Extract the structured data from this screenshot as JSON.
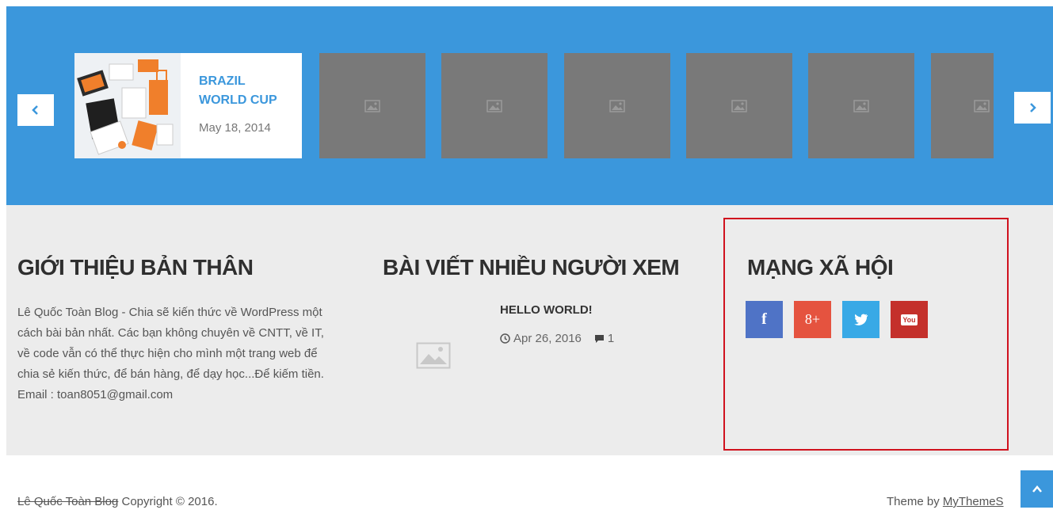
{
  "carousel": {
    "featured": {
      "title": "BRAZIL WORLD CUP",
      "date": "May 18, 2014"
    },
    "prev_icon": "chevron-left-icon",
    "next_icon": "chevron-right-icon",
    "placeholder_icon": "image-placeholder-icon",
    "background_color": "#3b97dc"
  },
  "about": {
    "title": "GIỚI THIỆU BẢN THÂN",
    "text": "Lê Quốc Toàn Blog - Chia sẽ kiến thức về WordPress một cách bài bản nhất. Các bạn không chuyên về CNTT, về IT, về code vẫn có thể thực hiện cho mình một trang web để chia sẻ kiến thức, để bán hàng, để dạy học...Để kiếm tiền. Email : toan8051@gmail.com"
  },
  "popular": {
    "title": "BÀI VIẾT NHIỀU NGƯỜI XEM",
    "post": {
      "title": "HELLO WORLD!",
      "date": "Apr 26, 2016",
      "comments": "1"
    }
  },
  "social": {
    "title": "MẠNG XÃ HỘI",
    "buttons": [
      {
        "icon": "facebook-icon",
        "glyph": "f",
        "color": "#4f73c6"
      },
      {
        "icon": "google-plus-icon",
        "glyph": "8+",
        "color": "#e5533f"
      },
      {
        "icon": "twitter-icon",
        "glyph": "t",
        "color": "#38a9e6"
      },
      {
        "icon": "youtube-icon",
        "glyph": "You",
        "color": "#c4302b"
      }
    ]
  },
  "footer": {
    "site_name": "Lê Quốc Toàn Blog",
    "copyright": " Copyright © 2016.",
    "theme_by": "Theme by ",
    "theme_link": "MyThemeS"
  },
  "highlight_color": "#d0121e"
}
